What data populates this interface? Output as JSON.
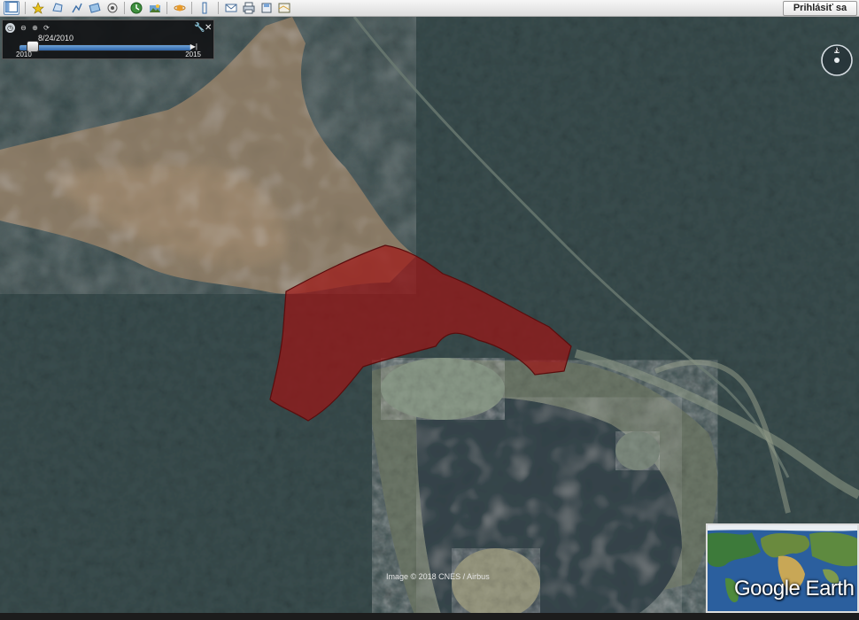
{
  "toolbar": {
    "buttons": [
      {
        "icon": "sidebar-icon"
      },
      {
        "icon": "placemark-icon"
      },
      {
        "icon": "polygon-icon"
      },
      {
        "icon": "path-icon"
      },
      {
        "icon": "overlay-icon"
      },
      {
        "icon": "tour-icon"
      },
      {
        "icon": "historical-imagery-icon"
      },
      {
        "icon": "sunlight-icon"
      },
      {
        "icon": "planets-icon"
      },
      {
        "icon": "ruler-icon"
      },
      {
        "icon": "email-icon"
      },
      {
        "icon": "print-icon"
      },
      {
        "icon": "save-image-icon"
      },
      {
        "icon": "view-in-maps-icon"
      }
    ],
    "sign_in_label": "Prihlásiť sa"
  },
  "time_slider": {
    "date": "8/24/2010",
    "start": "2010",
    "end": "2015",
    "position": 0.05
  },
  "compass": {
    "north_label": "N"
  },
  "map": {
    "credit": "Image © 2018 CNES / Airbus",
    "polygon_color": "#8b1a1a"
  },
  "overview": {
    "logo": "Google Earth"
  }
}
